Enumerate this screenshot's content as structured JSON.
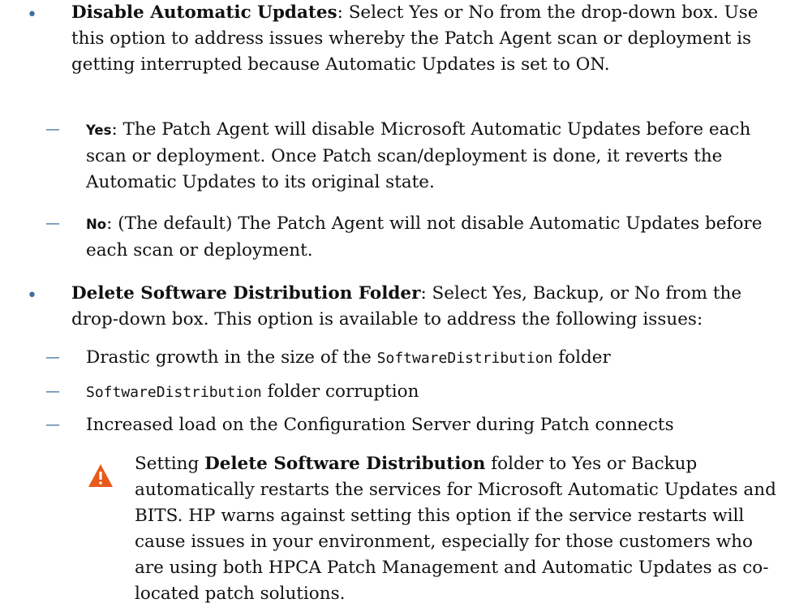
{
  "bullets": [
    {
      "term": "Disable Automatic Updates",
      "text": ": Select Yes or No from the drop-down box. Use this option to address issues whereby the Patch Agent scan or deployment is getting interrupted because Automatic Updates is set to ON."
    },
    {
      "term": "Delete Software Distribution Folder",
      "text": ": Select Yes, Backup, or No from the drop-down box. This option is available to address the following issues:"
    }
  ],
  "sub1": [
    {
      "dash": "—",
      "term": "Yes",
      "text": ": The Patch Agent will disable Microsoft Automatic Updates before each scan or deployment. Once Patch scan/deployment is done, it reverts the Automatic Updates to its original state."
    },
    {
      "dash": "—",
      "term": "No",
      "text": ": (The default) The Patch Agent will not disable Automatic Updates before each scan or deployment."
    }
  ],
  "sub2": [
    {
      "dash": "—",
      "pre": "Drastic growth in the size of the ",
      "code": "SoftwareDistribution",
      "post": " folder"
    },
    {
      "dash": "—",
      "pre": "",
      "code": "SoftwareDistribution",
      "post": " folder corruption"
    },
    {
      "dash": "—",
      "pre": "Increased load on the Configuration Server during Patch connects",
      "code": "",
      "post": ""
    }
  ],
  "note": {
    "pre": "Setting ",
    "strong": "Delete Software Distribution",
    "post": " folder to Yes or Backup automatically restarts the services for Microsoft Automatic Updates and BITS. HP warns against setting this option if the service restarts will cause issues in your environment, especially for those customers who are using both HPCA Patch Management and Automatic Updates as co-located patch solutions."
  },
  "bullet_symbol": "•",
  "warning_icon_color": "#e8591a",
  "accent_color": "#3d6f9e"
}
